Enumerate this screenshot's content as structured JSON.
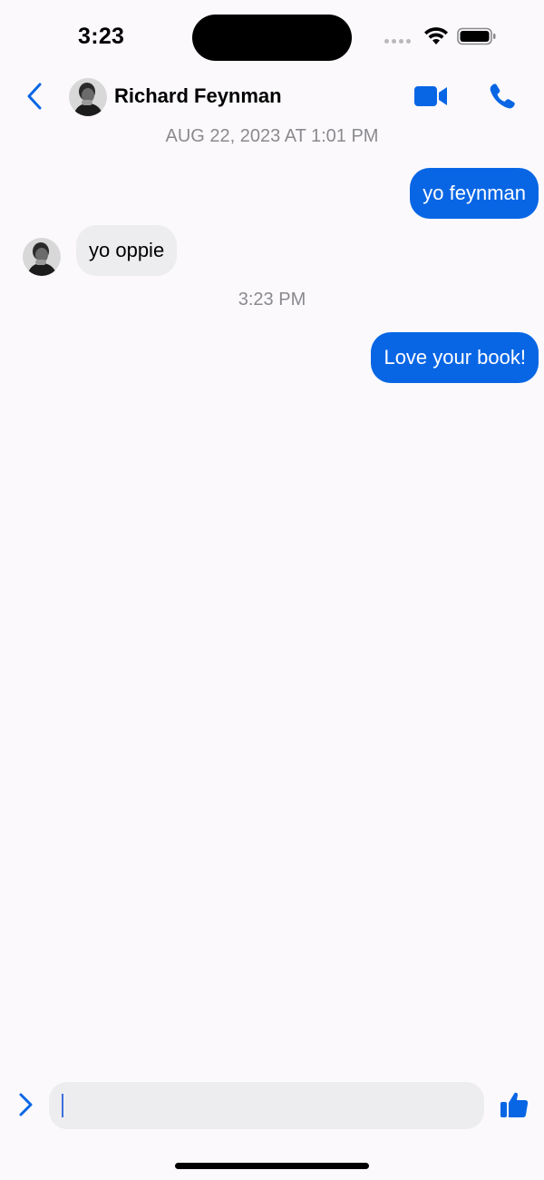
{
  "status_bar": {
    "time": "3:23",
    "icons": [
      "signal-dots-icon",
      "wifi-icon",
      "battery-icon"
    ]
  },
  "header": {
    "back_icon": "chevron-left-icon",
    "contact_name": "Richard Feynman",
    "video_icon": "video-camera-icon",
    "call_icon": "phone-icon"
  },
  "conversation": {
    "timestamps": [
      "AUG 22, 2023 AT 1:01 PM",
      "3:23 PM"
    ],
    "messages": [
      {
        "direction": "outgoing",
        "text": "yo feynman"
      },
      {
        "direction": "incoming",
        "text": "yo oppie"
      },
      {
        "direction": "outgoing",
        "text": "Love your book!"
      }
    ]
  },
  "composer": {
    "expand_icon": "chevron-right-icon",
    "input_value": "",
    "input_placeholder": "",
    "like_icon": "thumbs-up-icon"
  },
  "colors": {
    "accent": "#0866e5",
    "outgoing_bubble": "#0866e5",
    "incoming_bubble": "#ededf0",
    "background": "#fbf9fc",
    "timestamp_text": "#8a8a8e"
  }
}
